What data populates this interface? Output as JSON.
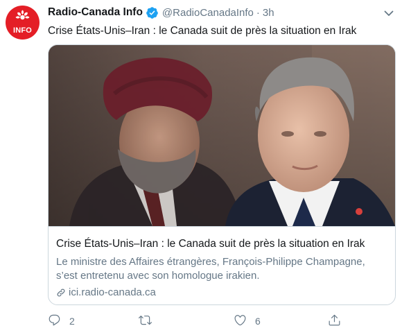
{
  "account": {
    "display_name": "Radio-Canada Info",
    "handle": "@RadioCanadaInfo",
    "separator": "·",
    "time": "3h",
    "avatar_text": "INFO",
    "brand_color": "#e41e26",
    "verified_color": "#1da1f2"
  },
  "tweet": {
    "text": "Crise États-Unis–Iran : le Canada suit de près la situation en Irak"
  },
  "card": {
    "title": "Crise États-Unis–Iran : le Canada suit de près la situation en Irak",
    "description": "Le ministre des Affaires étrangères, François-Philippe Champagne, s’est entretenu avec son homologue irakien.",
    "domain": "ici.radio-canada.ca",
    "image_alt": "photo-two-men-in-suits"
  },
  "actions": {
    "reply_count": "2",
    "retweet_count": "",
    "like_count": "6",
    "icons": [
      "reply-icon",
      "retweet-icon",
      "like-icon",
      "share-icon"
    ]
  }
}
